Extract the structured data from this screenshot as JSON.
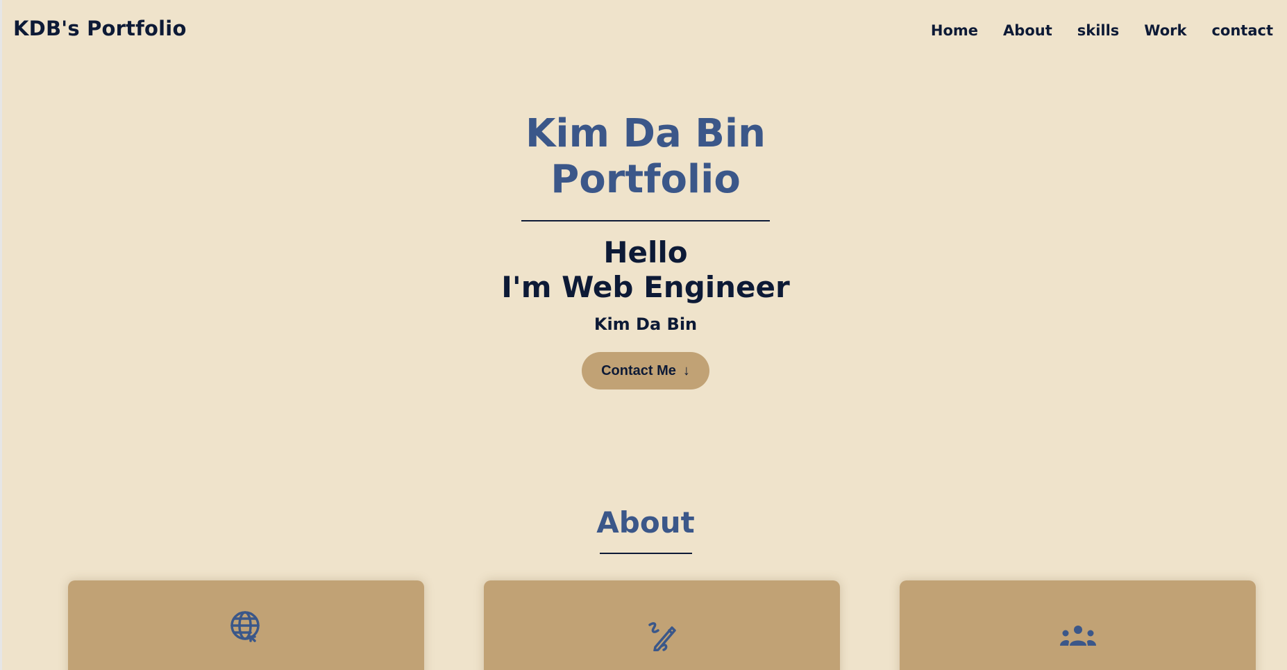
{
  "header": {
    "logo": "KDB's Portfolio",
    "nav": [
      "Home",
      "About",
      "skills",
      "Work",
      "contact"
    ]
  },
  "hero": {
    "title_line1": "Kim Da Bin",
    "title_line2": "Portfolio",
    "greeting_line1": "Hello",
    "greeting_line2": "I'm Web Engineer",
    "name": "Kim Da Bin",
    "button_label": "Contact Me",
    "button_arrow": "↓"
  },
  "about": {
    "title": "About",
    "cards": [
      {
        "icon": "globe-cursor-icon"
      },
      {
        "icon": "pencil-scribble-icon"
      },
      {
        "icon": "people-group-icon"
      }
    ]
  },
  "colors": {
    "background": "#efe3cb",
    "accent_blue": "#3b5789",
    "dark_navy": "#0d1a36",
    "card_tan": "#c1a275"
  }
}
